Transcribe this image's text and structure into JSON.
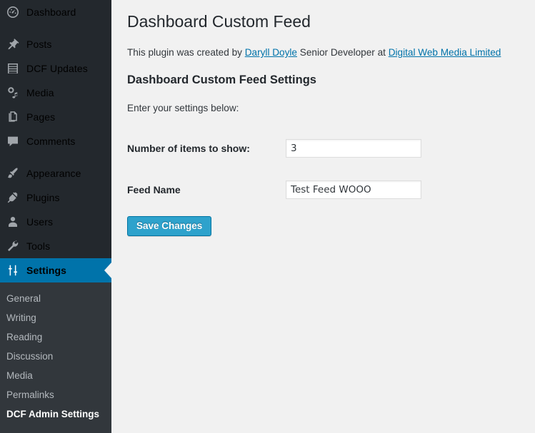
{
  "theme": {
    "menu_bg": "#23282d",
    "submenu_bg": "#32373c",
    "current_menu_bg": "#0073aa",
    "content_bg": "#f1f1f1",
    "link_color": "#0073aa",
    "button_bg": "#2ea2cc",
    "button_border": "#0074a2"
  },
  "sidebar": {
    "menu": [
      {
        "label": "Dashboard",
        "icon": "dashboard-gauge-icon",
        "name": "sidebar-item-dashboard",
        "current": false
      },
      {
        "label": "Posts",
        "icon": "pushpin-icon",
        "name": "sidebar-item-posts",
        "current": false
      },
      {
        "label": "DCF Updates",
        "icon": "list-view-icon",
        "name": "sidebar-item-dcf-updates",
        "current": false
      },
      {
        "label": "Media",
        "icon": "media-music-icon",
        "name": "sidebar-item-media",
        "current": false
      },
      {
        "label": "Pages",
        "icon": "pages-icon",
        "name": "sidebar-item-pages",
        "current": false
      },
      {
        "label": "Comments",
        "icon": "comment-bubble-icon",
        "name": "sidebar-item-comments",
        "current": false
      },
      {
        "label": "Appearance",
        "icon": "paintbrush-icon",
        "name": "sidebar-item-appearance",
        "current": false
      },
      {
        "label": "Plugins",
        "icon": "plug-icon",
        "name": "sidebar-item-plugins",
        "current": false
      },
      {
        "label": "Users",
        "icon": "user-icon",
        "name": "sidebar-item-users",
        "current": false
      },
      {
        "label": "Tools",
        "icon": "wrench-icon",
        "name": "sidebar-item-tools",
        "current": false
      },
      {
        "label": "Settings",
        "icon": "settings-sliders-icon",
        "name": "sidebar-item-settings",
        "current": true
      }
    ],
    "submenu": [
      {
        "label": "General",
        "name": "submenu-item-general",
        "current": false
      },
      {
        "label": "Writing",
        "name": "submenu-item-writing",
        "current": false
      },
      {
        "label": "Reading",
        "name": "submenu-item-reading",
        "current": false
      },
      {
        "label": "Discussion",
        "name": "submenu-item-discussion",
        "current": false
      },
      {
        "label": "Media",
        "name": "submenu-item-media",
        "current": false
      },
      {
        "label": "Permalinks",
        "name": "submenu-item-permalinks",
        "current": false
      },
      {
        "label": "DCF Admin Settings",
        "name": "submenu-item-dcf-admin-settings",
        "current": true
      }
    ]
  },
  "main": {
    "page_title": "Dashboard Custom Feed",
    "byline": {
      "prefix": "This plugin was created by ",
      "author_link": "Daryll Doyle",
      "middle": " Senior Developer at ",
      "company_link": "Digital Web Media Limited"
    },
    "section_title": "Dashboard Custom Feed Settings",
    "intro": "Enter your settings below:",
    "fields": [
      {
        "label": "Number of items to show:",
        "value": "3",
        "placeholder": "",
        "name": "number-of-items-input"
      },
      {
        "label": "Feed Name",
        "value": "Test Feed WOOO",
        "placeholder": "",
        "name": "feed-name-input"
      }
    ],
    "submit_label": "Save Changes"
  }
}
